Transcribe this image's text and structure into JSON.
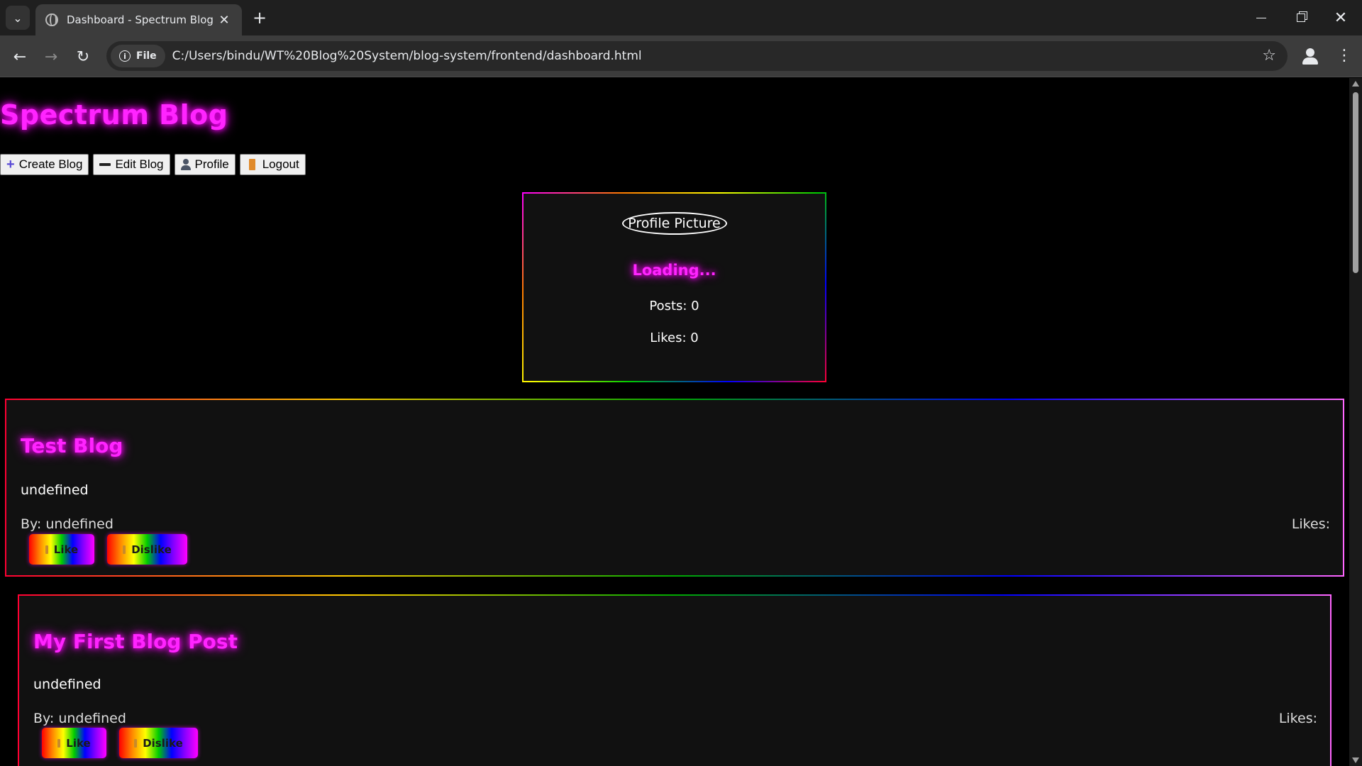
{
  "browser": {
    "tab_title": "Dashboard - Spectrum Blog",
    "close_glyph": "✕",
    "new_tab_glyph": "+",
    "chip_label": "File",
    "url": "C:/Users/bindu/WT%20Blog%20System/blog-system/frontend/dashboard.html",
    "icons": [
      "search-tabs-icon",
      "globe-icon",
      "close-icon",
      "plus-icon",
      "back-icon",
      "forward-icon",
      "reload-icon",
      "info-icon",
      "star-icon",
      "profile-icon",
      "menu-icon"
    ]
  },
  "page": {
    "site_title": "Spectrum Blog",
    "nav": {
      "create": "Create Blog",
      "edit": "Edit Blog",
      "profile": "Profile",
      "logout": "Logout"
    },
    "profile_card": {
      "picture_alt": "Profile Picture",
      "username": "Loading...",
      "posts": "Posts: 0",
      "likes": "Likes: 0"
    },
    "blogs": [
      {
        "title": "Test Blog",
        "content": "undefined",
        "author": "By: undefined",
        "likes": "Likes:",
        "like_label": "Like",
        "dislike_label": "Dislike"
      },
      {
        "title": "My First Blog Post",
        "content": "undefined",
        "author": "By: undefined",
        "likes": "Likes:",
        "like_label": "Like",
        "dislike_label": "Dislike"
      }
    ]
  },
  "colors": {
    "neon_magenta": "#ff24ff",
    "background": "#000000",
    "card_background": "#111111"
  }
}
